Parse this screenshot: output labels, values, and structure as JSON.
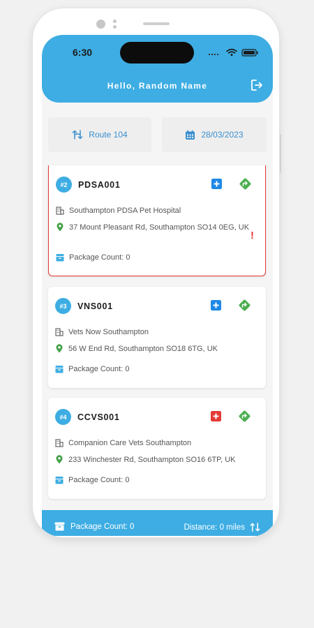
{
  "status_bar": {
    "time": "6:30"
  },
  "header": {
    "greeting": "Hello, Random Name",
    "logout_icon": "logout-icon"
  },
  "route": {
    "label": "Route 104",
    "date": "28/03/2023"
  },
  "stops": [
    {
      "badge": "#2",
      "code": "PDSA001",
      "name": "Southampton PDSA Pet Hospital",
      "address": "37 Mount Pleasant Rd, Southampton SO14 0EG, UK",
      "package_count": "Package Count: 0",
      "alert": "!",
      "add_button_color": "#1e88e5",
      "has_alert": true
    },
    {
      "badge": "#3",
      "code": "VNS001",
      "name": "Vets Now Southampton",
      "address": "56 W End Rd, Southampton SO18 6TG, UK",
      "package_count": "Package Count: 0",
      "add_button_color": "#1e88e5",
      "has_alert": false
    },
    {
      "badge": "#4",
      "code": "CCVS001",
      "name": "Companion Care Vets Southampton",
      "address": "233 Winchester Rd, Southampton SO16 6TP, UK",
      "package_count": "Package Count: 0",
      "add_button_color": "#e53935",
      "has_alert": false
    }
  ],
  "footer": {
    "package_count": "Package Count: 0",
    "distance": "Distance: 0 miles"
  },
  "colors": {
    "primary": "#3dade3",
    "tile_text": "#3a8fcf",
    "alert": "#e53935",
    "nav_green": "#4caf50",
    "pin_green": "#43a047"
  }
}
